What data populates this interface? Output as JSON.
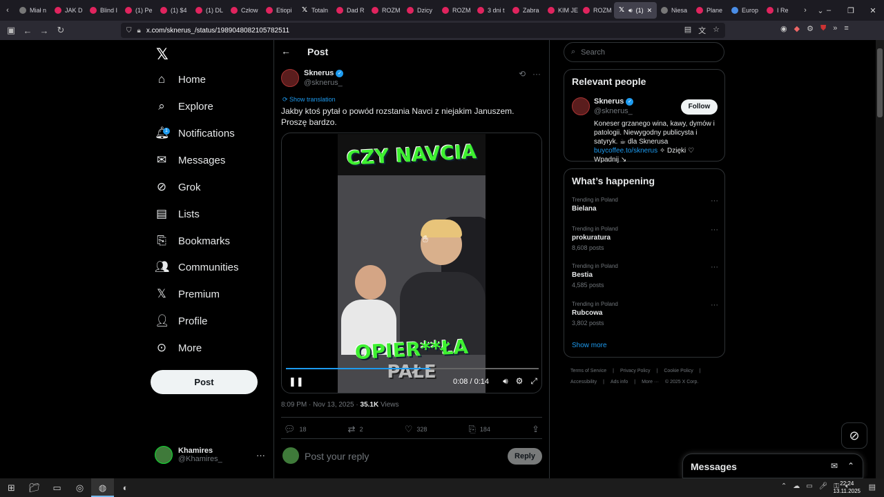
{
  "browser": {
    "tabs": [
      {
        "label": "Miał n",
        "icon": "tab-favicon-icon"
      },
      {
        "label": "JAK D",
        "icon": "youtube-icon"
      },
      {
        "label": "Blind I",
        "icon": "youtube-icon"
      },
      {
        "label": "(1) Pe",
        "icon": "youtube-icon"
      },
      {
        "label": "(1) $4",
        "icon": "youtube-icon"
      },
      {
        "label": "(1) DL",
        "icon": "youtube-icon"
      },
      {
        "label": "Człow",
        "icon": "youtube-icon"
      },
      {
        "label": "Etiopi",
        "icon": "youtube-icon"
      },
      {
        "label": "Totaln",
        "icon": "x-icon"
      },
      {
        "label": "Dad R",
        "icon": "youtube-icon"
      },
      {
        "label": "ROZM",
        "icon": "youtube-icon"
      },
      {
        "label": "Dzicy",
        "icon": "youtube-icon"
      },
      {
        "label": "ROZM",
        "icon": "youtube-icon"
      },
      {
        "label": "3 dni t",
        "icon": "youtube-icon"
      },
      {
        "label": "Zabra",
        "icon": "youtube-icon"
      },
      {
        "label": "KIM JE",
        "icon": "youtube-icon"
      },
      {
        "label": "ROZM",
        "icon": "youtube-icon"
      },
      {
        "label": "(1)",
        "icon": "x-icon",
        "active": true
      },
      {
        "label": "Niesa",
        "icon": "email-icon"
      },
      {
        "label": "Plane",
        "icon": "youtube-icon"
      },
      {
        "label": "Europ",
        "icon": "globe-icon"
      },
      {
        "label": "I Re",
        "icon": "youtube-icon"
      }
    ],
    "url": "x.com/sknerus_/status/1989048082105782511"
  },
  "nav": {
    "items": [
      {
        "label": "Home",
        "icon": "home-icon"
      },
      {
        "label": "Explore",
        "icon": "search-icon"
      },
      {
        "label": "Notifications",
        "icon": "bell-icon",
        "badge": "1"
      },
      {
        "label": "Messages",
        "icon": "envelope-icon"
      },
      {
        "label": "Grok",
        "icon": "grok-icon"
      },
      {
        "label": "Lists",
        "icon": "list-icon"
      },
      {
        "label": "Bookmarks",
        "icon": "bookmark-icon"
      },
      {
        "label": "Communities",
        "icon": "people-icon"
      },
      {
        "label": "Premium",
        "icon": "x-icon"
      },
      {
        "label": "Profile",
        "icon": "person-icon"
      },
      {
        "label": "More",
        "icon": "more-circle-icon"
      }
    ],
    "post_button": "Post",
    "account": {
      "name": "Khamires",
      "handle": "@Khamires_"
    }
  },
  "post": {
    "header": "Post",
    "author": {
      "name": "Sknerus",
      "handle": "@sknerus_"
    },
    "show_translation": "Show translation",
    "text": "Jakby ktoś pytał o powód rozstania Navci z niejakim Januszem. Proszę bardzo.",
    "video": {
      "caption_top": "CZY NAVCIA",
      "caption_bottom1": "OPIER**ŁA",
      "caption_bottom2": "PAŁE",
      "time": "0:08 / 0:14",
      "progress": 0.57
    },
    "timestamp": "8:09 PM · Nov 13, 2025 · ",
    "views_count": "35.1K",
    "views_label": " Views",
    "stats": {
      "replies": "18",
      "reposts": "2",
      "likes": "328",
      "bookmarks": "184"
    },
    "reply_placeholder": "Post your reply",
    "reply_button": "Reply"
  },
  "sidebar": {
    "search_placeholder": "Search",
    "relevant_title": "Relevant people",
    "person": {
      "name": "Sknerus",
      "handle": "@sknerus_",
      "follow": "Follow",
      "bio_text": "Koneser grzanego wina, kawy, dymów i patologii. Niewygodny publicysta i satyryk. ☕ dla Sknerusa ",
      "bio_link": "buycoffee.to/sknerus",
      "bio_tail": " ✧ Dzięki ♡ Wpadnij ↘"
    },
    "happening_title": "What’s happening",
    "trends": [
      {
        "context": "Trending in Poland",
        "name": "Bielana",
        "count": ""
      },
      {
        "context": "Trending in Poland",
        "name": "prokuratura",
        "count": "8,608 posts"
      },
      {
        "context": "Trending in Poland",
        "name": "Bestia",
        "count": "4,585 posts"
      },
      {
        "context": "Trending in Poland",
        "name": "Rubcowa",
        "count": "3,802 posts"
      }
    ],
    "show_more": "Show more",
    "footer": [
      "Terms of Service",
      "|",
      "Privacy Policy",
      "|",
      "Cookie Policy",
      "|",
      "Accessibility",
      "|",
      "Ads info",
      "|",
      "More ···",
      "© 2025 X Corp."
    ]
  },
  "messages_drawer": {
    "title": "Messages"
  },
  "taskbar": {
    "time": "22:24",
    "date": "13.11.2025"
  }
}
